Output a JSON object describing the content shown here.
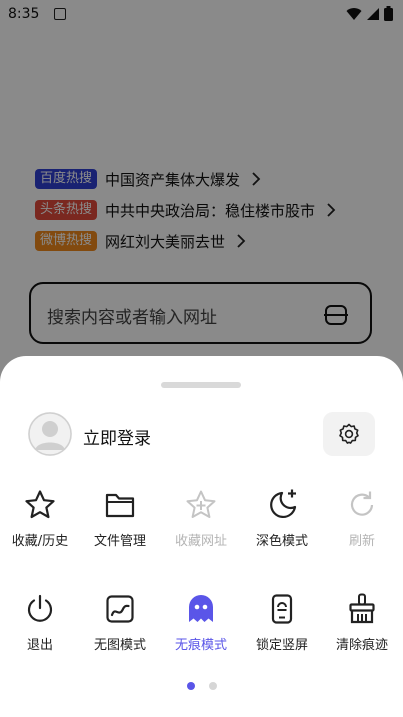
{
  "status_bar": {
    "time": "8:35"
  },
  "hot_searches": [
    {
      "source": "百度热搜",
      "text": "中国资产集体大爆发",
      "color": "#2f3fd2"
    },
    {
      "source": "头条热搜",
      "text": "中共中央政治局：稳住楼市股市",
      "color": "#e24a3b"
    },
    {
      "source": "微博热搜",
      "text": "网红刘大美丽去世",
      "color": "#f08a1c"
    }
  ],
  "search": {
    "placeholder": "搜索内容或者输入网址"
  },
  "sheet": {
    "login_label": "立即登录",
    "row1": [
      {
        "label": "收藏/历史",
        "icon": "star-icon",
        "enabled": true
      },
      {
        "label": "文件管理",
        "icon": "folder-icon",
        "enabled": true
      },
      {
        "label": "收藏网址",
        "icon": "star-plus-icon",
        "enabled": false
      },
      {
        "label": "深色模式",
        "icon": "moon-icon",
        "enabled": true
      },
      {
        "label": "刷新",
        "icon": "refresh-icon",
        "enabled": false
      }
    ],
    "row2": [
      {
        "label": "退出",
        "icon": "power-icon",
        "active": false
      },
      {
        "label": "无图模式",
        "icon": "image-off-icon",
        "active": false
      },
      {
        "label": "无痕模式",
        "icon": "ghost-icon",
        "active": true
      },
      {
        "label": "锁定竖屏",
        "icon": "portrait-lock-icon",
        "active": false
      },
      {
        "label": "清除痕迹",
        "icon": "broom-icon",
        "active": false
      }
    ],
    "pager": {
      "current": 1,
      "total": 2
    }
  },
  "colors": {
    "accent": "#5a55e8",
    "disabled": "#b4b4b4",
    "dot_inactive": "#d6d6d6"
  }
}
